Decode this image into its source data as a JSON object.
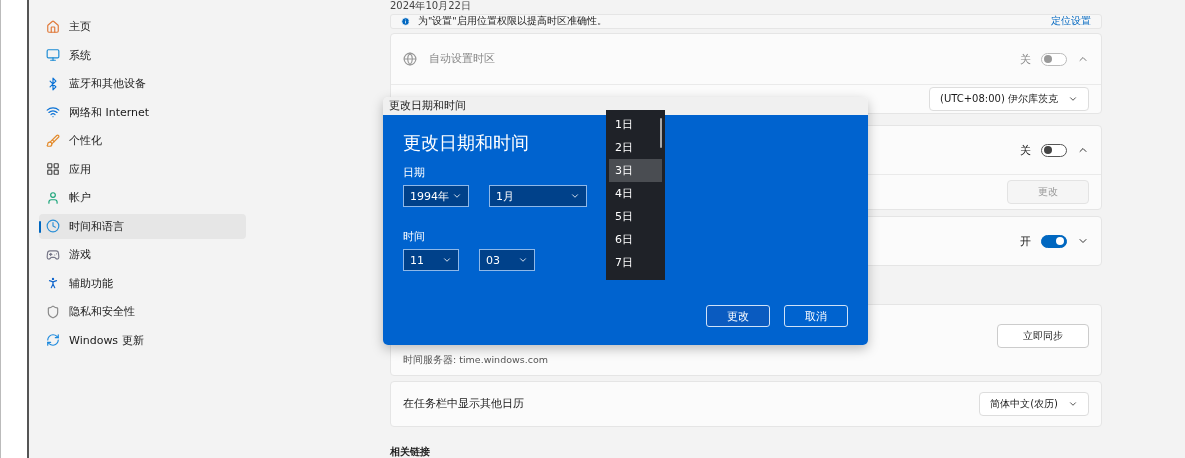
{
  "sidebar": {
    "items": [
      {
        "label": "主页",
        "selected": false
      },
      {
        "label": "系统",
        "selected": false
      },
      {
        "label": "蓝牙和其他设备",
        "selected": false
      },
      {
        "label": "网络和 Internet",
        "selected": false
      },
      {
        "label": "个性化",
        "selected": false
      },
      {
        "label": "应用",
        "selected": false
      },
      {
        "label": "帐户",
        "selected": false
      },
      {
        "label": "时间和语言",
        "selected": true
      },
      {
        "label": "游戏",
        "selected": false
      },
      {
        "label": "辅助功能",
        "selected": false
      },
      {
        "label": "隐私和安全性",
        "selected": false
      },
      {
        "label": "Windows 更新",
        "selected": false
      }
    ]
  },
  "date": "2024年10月22日",
  "info_bar": {
    "text": "为\"设置\"启用位置权限以提高时区准确性。",
    "link": "定位设置"
  },
  "toggle_cards": [
    {
      "label": "自动设置时区",
      "disabled": true,
      "state_text": "关",
      "on": false,
      "expanded": true,
      "sub": {
        "kind": "dropdown",
        "value": "(UTC+08:00) 伊尔库茨克"
      }
    },
    {
      "state_text": "关",
      "on": false,
      "expanded": true,
      "sub": {
        "kind": "button",
        "value": "更改",
        "disabled": true
      }
    },
    {
      "state_text": "开",
      "on": true,
      "expanded": false
    }
  ],
  "sync_card": {
    "detail": "时间服务器: time.windows.com",
    "button": "立即同步"
  },
  "calendar_card": {
    "label": "在任务栏中显示其他日历",
    "value": "简体中文(农历)"
  },
  "related_heading": "相关链接",
  "dialog": {
    "title": "更改日期和时间",
    "heading": "更改日期和时间",
    "date_label": "日期",
    "year": "1994年",
    "month": "1月",
    "time_label": "时间",
    "hour": "11",
    "minute": "03",
    "buttons": [
      "更改",
      "取消"
    ],
    "day_list": [
      {
        "label": "1日",
        "selected": false
      },
      {
        "label": "2日",
        "selected": false
      },
      {
        "label": "3日",
        "selected": true
      },
      {
        "label": "4日",
        "selected": false
      },
      {
        "label": "5日",
        "selected": false
      },
      {
        "label": "6日",
        "selected": false
      },
      {
        "label": "7日",
        "selected": false
      }
    ]
  }
}
